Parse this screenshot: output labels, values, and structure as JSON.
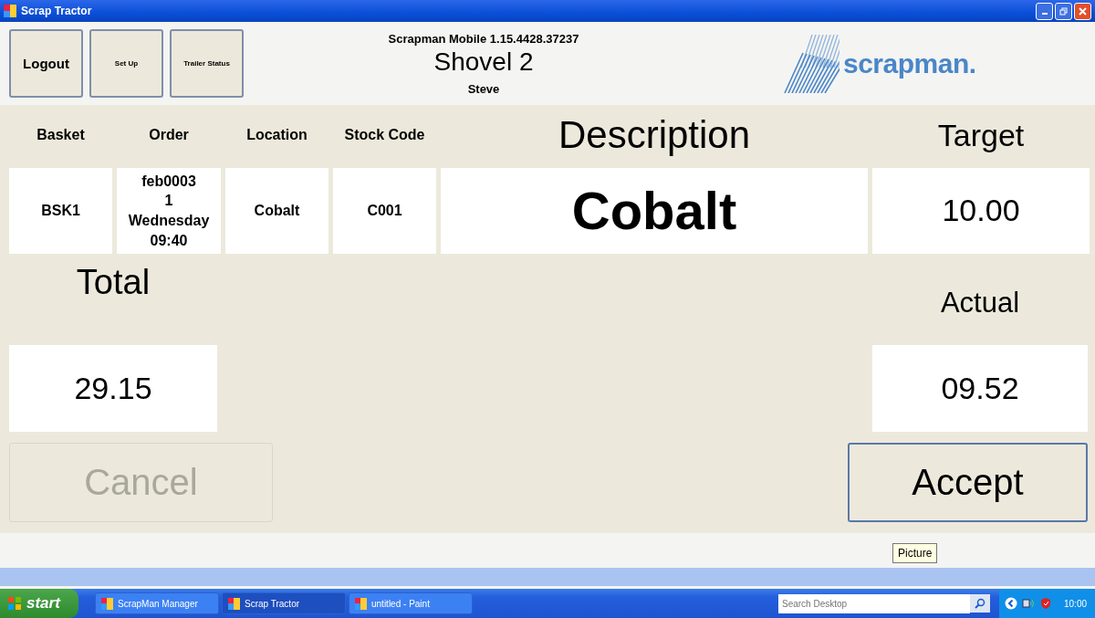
{
  "window": {
    "title": "Scrap Tractor"
  },
  "header_buttons": [
    {
      "label": "Logout",
      "kind": "large"
    },
    {
      "label": "Set Up",
      "kind": "small"
    },
    {
      "label": "Trailer Status",
      "kind": "small"
    }
  ],
  "header": {
    "version": "Scrapman Mobile 1.15.4428.37237",
    "station": "Shovel 2",
    "user": "Steve",
    "logo": "scrapman."
  },
  "table": {
    "columns": [
      {
        "label": "Basket",
        "kind": "small"
      },
      {
        "label": "Order",
        "kind": "small"
      },
      {
        "label": "Location",
        "kind": "small"
      },
      {
        "label": "Stock Code",
        "kind": "small"
      },
      {
        "label": "Description",
        "kind": "large"
      },
      {
        "label": "Target",
        "kind": "medium"
      }
    ],
    "cells": [
      {
        "lines": [
          "BSK1"
        ],
        "kind": "small"
      },
      {
        "lines": [
          "feb0003",
          "1",
          "Wednesday",
          "09:40"
        ],
        "kind": "small"
      },
      {
        "lines": [
          "Cobalt"
        ],
        "kind": "small"
      },
      {
        "lines": [
          "C001"
        ],
        "kind": "small"
      },
      {
        "lines": [
          "Cobalt"
        ],
        "kind": "large"
      },
      {
        "lines": [
          "10.00"
        ],
        "kind": "medium"
      }
    ]
  },
  "total": {
    "label": "Total",
    "value": "29.15"
  },
  "actual": {
    "label": "Actual",
    "value": "09.52"
  },
  "actions": [
    {
      "label": "Cancel",
      "disabled": true
    },
    {
      "label": "Accept",
      "disabled": false
    }
  ],
  "taskbar": {
    "start": "start",
    "items": [
      {
        "label": "ScrapMan Manager",
        "selected": false
      },
      {
        "label": "Scrap Tractor",
        "selected": true
      },
      {
        "label": "untitled - Paint",
        "selected": false
      }
    ],
    "search": {
      "placeholder": "Search Desktop"
    },
    "clock": "10:00",
    "tooltip": "Picture"
  }
}
